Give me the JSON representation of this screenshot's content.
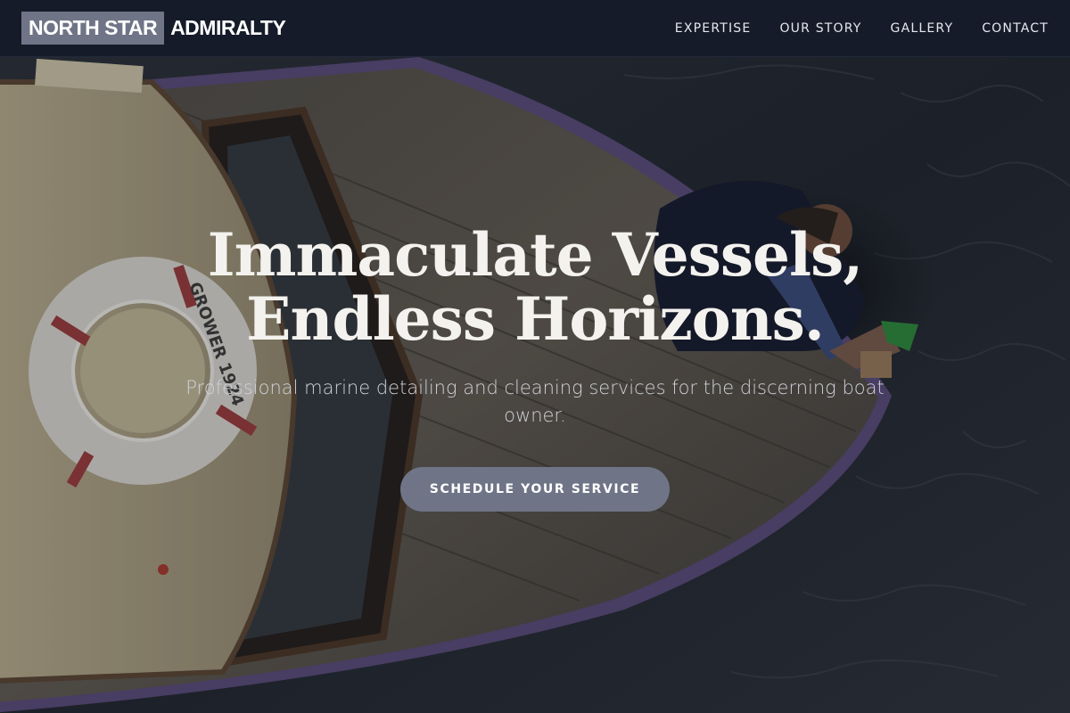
{
  "nav": {
    "brand_highlight": "NORTH STAR",
    "brand_rest": "ADMIRALTY",
    "links": [
      "EXPERTISE",
      "OUR STORY",
      "GALLERY",
      "CONTACT"
    ]
  },
  "hero": {
    "title_line1": "Immaculate Vessels,",
    "title_line2": "Endless Horizons.",
    "subtitle": "Professional marine detailing and cleaning services for the discerning boat owner.",
    "cta_label": "SCHEDULE YOUR SERVICE",
    "life_ring_text": "GROWER 1924"
  },
  "colors": {
    "nav_bg": "#151b29",
    "accent": "#6f7587",
    "water": "#232a35",
    "deck": "#6e6658"
  }
}
